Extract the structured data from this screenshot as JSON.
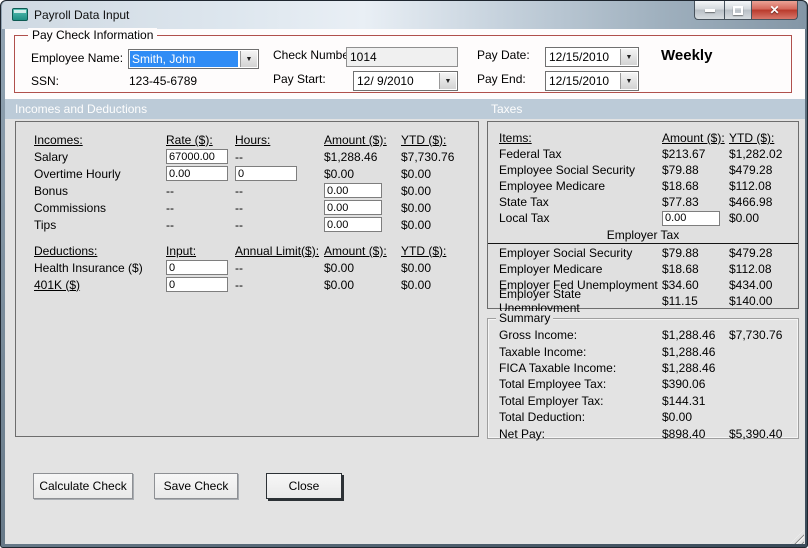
{
  "window": {
    "title": "Payroll Data Input",
    "icons": {
      "app": "form-icon",
      "minimize": "minimize-icon",
      "maximize": "maximize-icon",
      "close": "close-icon",
      "dropdown": "chevron-down-icon"
    },
    "close_glyph": "✕",
    "dropdown_glyph": "▼"
  },
  "paycheck": {
    "group_title": "Pay Check Information",
    "employee_name": {
      "label": "Employee Name:",
      "value": "Smith, John"
    },
    "ssn": {
      "label": "SSN:",
      "value": "123-45-6789"
    },
    "check_number": {
      "label": "Check Number:",
      "value": "1014"
    },
    "pay_start": {
      "label": "Pay Start:",
      "value": "12/ 9/2010"
    },
    "pay_date": {
      "label": "Pay Date:",
      "value": "12/15/2010"
    },
    "pay_end": {
      "label": "Pay End:",
      "value": "12/15/2010"
    },
    "frequency": "Weekly"
  },
  "sections": {
    "left_title": "Incomes and Deductions",
    "right_title": "Taxes"
  },
  "incomes": {
    "headers": {
      "name": "Incomes:",
      "rate": "Rate ($):",
      "hours": "Hours:",
      "amount": "Amount ($):",
      "ytd": "YTD ($):"
    },
    "rows": [
      {
        "name": "Salary",
        "rate": "67000.00",
        "hours": "--",
        "amount": "$1,288.46",
        "ytd": "$7,730.76"
      },
      {
        "name": "Overtime Hourly",
        "rate": "0.00",
        "hours": "0",
        "amount": "$0.00",
        "ytd": "$0.00"
      },
      {
        "name": "Bonus",
        "rate": "--",
        "hours": "--",
        "amount": "0.00",
        "ytd": "$0.00"
      },
      {
        "name": "Commissions",
        "rate": "--",
        "hours": "--",
        "amount": "0.00",
        "ytd": "$0.00"
      },
      {
        "name": "Tips",
        "rate": "--",
        "hours": "--",
        "amount": "0.00",
        "ytd": "$0.00"
      }
    ]
  },
  "deductions": {
    "headers": {
      "name": "Deductions:",
      "input": "Input:",
      "limit": "Annual Limit($):",
      "amount": "Amount ($):",
      "ytd": "YTD ($):"
    },
    "rows": [
      {
        "name": "Health Insurance  ($)",
        "input": "0",
        "limit": "--",
        "amount": "$0.00",
        "ytd": "$0.00"
      },
      {
        "name": "401K  ($)",
        "input": "0",
        "limit": "--",
        "amount": "$0.00",
        "ytd": "$0.00"
      }
    ]
  },
  "taxes": {
    "headers": {
      "name": "Items:",
      "amount": "Amount ($):",
      "ytd": "YTD ($):"
    },
    "employee_rows": [
      {
        "name": "Federal Tax",
        "amount": "$213.67",
        "ytd": "$1,282.02"
      },
      {
        "name": "Employee Social Security",
        "amount": "$79.88",
        "ytd": "$479.28"
      },
      {
        "name": "Employee Medicare",
        "amount": "$18.68",
        "ytd": "$112.08"
      },
      {
        "name": "State Tax",
        "amount": "$77.83",
        "ytd": "$466.98"
      },
      {
        "name": "Local Tax",
        "amount": "0.00",
        "ytd": "$0.00"
      }
    ],
    "employer_header": "Employer Tax",
    "employer_rows": [
      {
        "name": "Employer Social Security",
        "amount": "$79.88",
        "ytd": "$479.28"
      },
      {
        "name": "Employer Medicare",
        "amount": "$18.68",
        "ytd": "$112.08"
      },
      {
        "name": "Employer Fed Unemployment",
        "amount": "$34.60",
        "ytd": "$434.00"
      },
      {
        "name": "Employer State Unemployment",
        "amount": "$11.15",
        "ytd": "$140.00"
      }
    ]
  },
  "summary": {
    "group_title": "Summary",
    "rows": [
      {
        "label": "Gross Income:",
        "amount": "$1,288.46",
        "ytd": "$7,730.76"
      },
      {
        "label": "Taxable Income:",
        "amount": "$1,288.46",
        "ytd": ""
      },
      {
        "label": "FICA Taxable Income:",
        "amount": "$1,288.46",
        "ytd": ""
      },
      {
        "label": "Total Employee Tax:",
        "amount": "$390.06",
        "ytd": ""
      },
      {
        "label": "Total Employer Tax:",
        "amount": "$144.31",
        "ytd": ""
      },
      {
        "label": "Total Deduction:",
        "amount": "$0.00",
        "ytd": ""
      },
      {
        "label": "Net Pay:",
        "amount": "$898.40",
        "ytd": "$5,390.40"
      }
    ]
  },
  "buttons": {
    "calculate": "Calculate Check",
    "save": "Save Check",
    "close": "Close"
  },
  "colors": {
    "band_background": "#bccbd8",
    "group_border_red": "#b0504c",
    "selection_blue": "#2f8cf5",
    "close_button_red": "#b93a2c"
  }
}
